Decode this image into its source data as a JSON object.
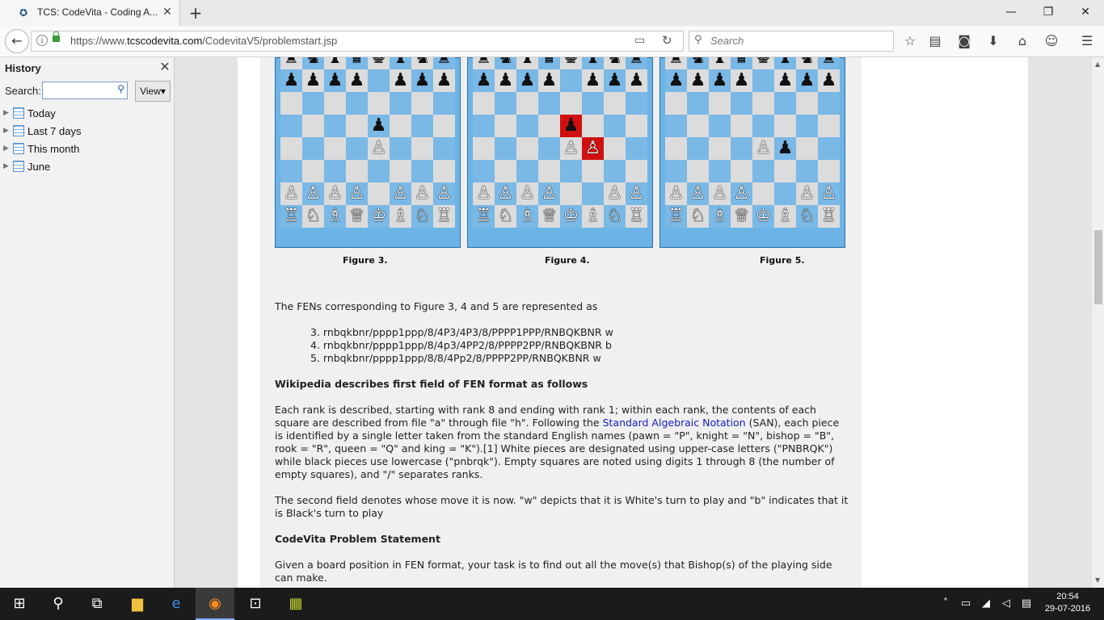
{
  "browser": {
    "tab_title": "TCS: CodeVita - Coding A...",
    "new_tab": "+",
    "url_prefix": "https://www.",
    "url_domain": "tcscodevita.com",
    "url_path": "/CodevitaV5/problemstart.jsp",
    "search_placeholder": "Search",
    "window_controls": [
      "—",
      "❐",
      "✕"
    ]
  },
  "sidebar": {
    "title": "History",
    "search_label": "Search:",
    "view_label": "View",
    "items": [
      {
        "label": "Today"
      },
      {
        "label": "Last 7 days"
      },
      {
        "label": "This month"
      },
      {
        "label": "June"
      }
    ]
  },
  "figures": [
    {
      "caption": "Figure 3.",
      "fen": "rnbqkbnr/pppp1ppp/8/4p3/4P3/8/PPPP1PPP/RNBQKBNR",
      "highlight": []
    },
    {
      "caption": "Figure 4.",
      "fen": "rnbqkbnr/pppp1ppp/8/4p3/4PP2/8/PPPP2PP/RNBQKBNR",
      "highlight": [
        "e5",
        "f4"
      ]
    },
    {
      "caption": "Figure 5.",
      "fen": "rnbqkbnr/pppp1ppp/8/8/4Pp2/8/PPPP2PP/RNBQKBNR",
      "highlight": []
    }
  ],
  "content": {
    "intro": "The FENs corresponding to Figure 3, 4 and 5 are represented as",
    "fen_list": [
      "3. rnbqkbnr/pppp1ppp/8/4P3/4P3/8/PPPP1PPP/RNBQKBNR w",
      "4. rnbqkbnr/pppp1ppp/8/4p3/4PP2/8/PPPP2PP/RNBQKBNR b",
      "5. rnbqkbnr/pppp1ppp/8/8/4Pp2/8/PPPP2PP/RNBQKBNR w"
    ],
    "heading1": "Wikipedia describes first field of FEN format as follows",
    "para1_a": "Each rank is described, starting with rank 8 and ending with rank 1; within each rank, the contents of each square are described from file \"a\" through file \"h\". Following the ",
    "para1_link": "Standard Algebraic Notation",
    "para1_b": " (SAN), each piece is identified by a single letter taken from the standard English names (pawn = \"P\", knight = \"N\", bishop = \"B\", rook = \"R\", queen = \"Q\" and king = \"K\").[1] White pieces are designated using upper-case letters (\"PNBRQK\") while black pieces use lowercase (\"pnbrqk\"). Empty squares are noted using digits 1 through 8 (the number of empty squares), and \"/\" separates ranks.",
    "para2": "The second field denotes whose move it is now. \"w\" depicts that it is White's turn to play and \"b\" indicates that it is Black's turn to play",
    "heading2": "CodeVita Problem Statement",
    "para3": "Given a board position in FEN format, your task is to find out all the move(s) that Bishop(s) of the playing side can make."
  },
  "taskbar": {
    "time": "20:54",
    "date": "29-07-2016"
  },
  "colors": {
    "board_light": "#dcdcdc",
    "board_dark": "#7ab8e6",
    "highlight": "#d01010",
    "link": "#1a1ac0"
  }
}
